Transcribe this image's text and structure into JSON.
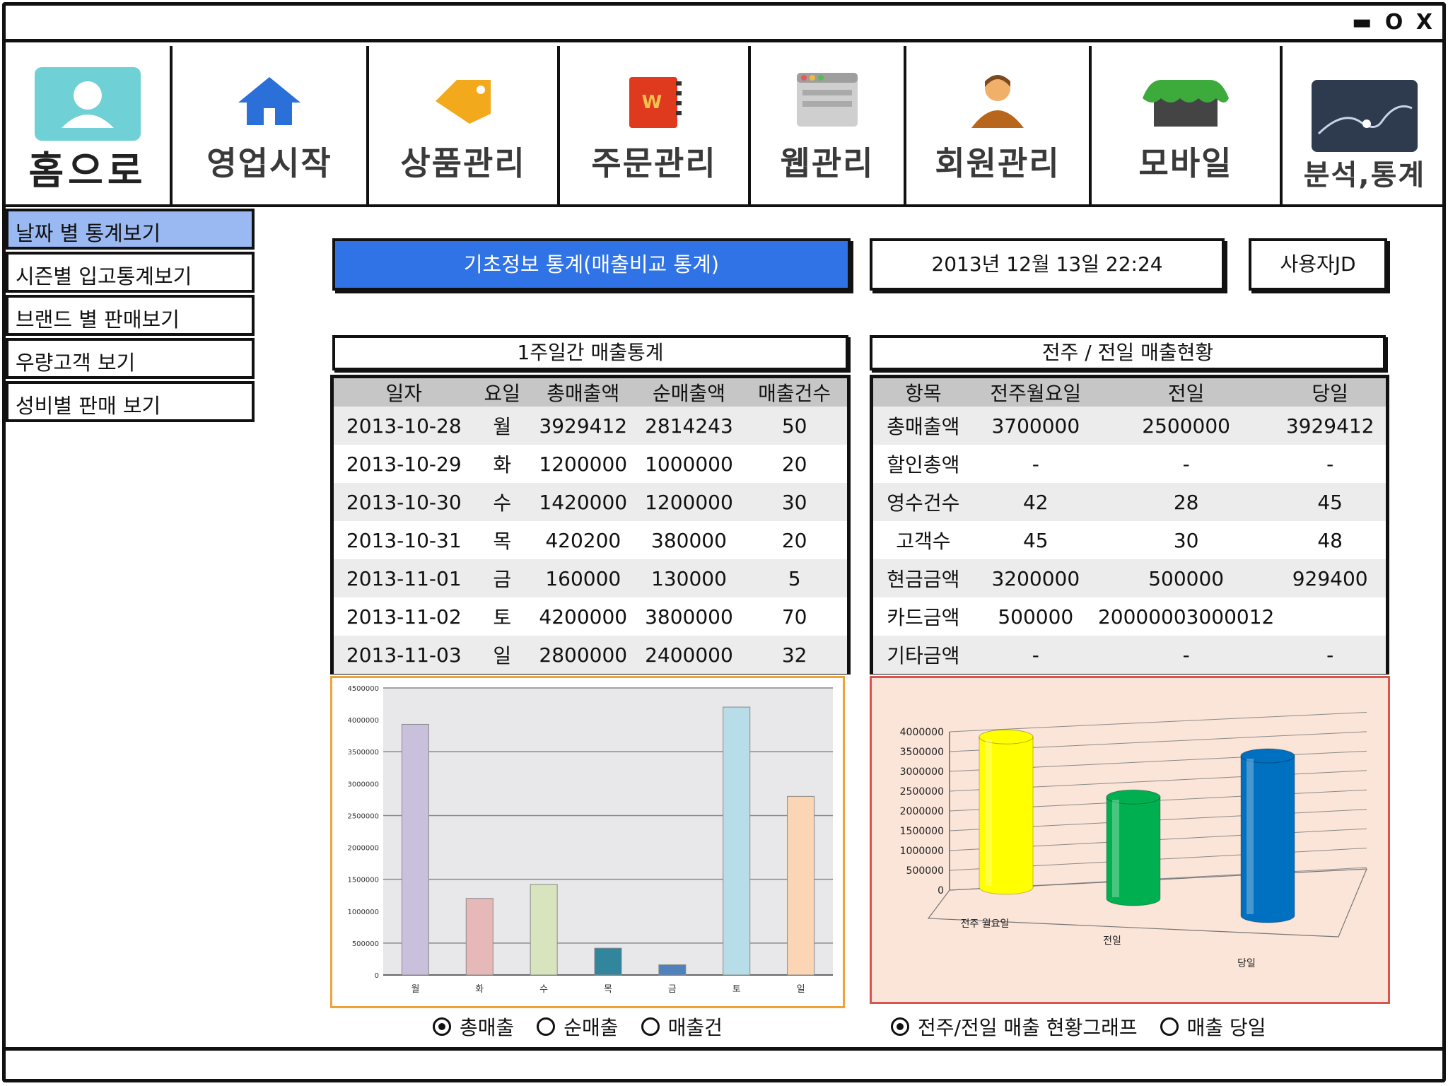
{
  "window": {
    "controls": {
      "minimize": "▬",
      "maximize": "O",
      "close": "X"
    }
  },
  "nav": {
    "home": "홈으로",
    "items": [
      {
        "label": "영업시작",
        "icon": "house-icon"
      },
      {
        "label": "상품관리",
        "icon": "tag-icon"
      },
      {
        "label": "주문관리",
        "icon": "notebook-icon"
      },
      {
        "label": "웹관리",
        "icon": "browser-window-icon"
      },
      {
        "label": "회원관리",
        "icon": "person-icon"
      },
      {
        "label": "모바일",
        "icon": "storefront-icon"
      },
      {
        "label": "분석,통계",
        "icon": "line-chart-icon"
      }
    ]
  },
  "sidebar": {
    "items": [
      {
        "label": "날짜 별 통계보기",
        "active": true
      },
      {
        "label": "시즌별 입고통계보기",
        "active": false
      },
      {
        "label": "브랜드 별 판매보기",
        "active": false
      },
      {
        "label": "우량고객 보기",
        "active": false
      },
      {
        "label": "성비별 판매 보기",
        "active": false
      }
    ]
  },
  "header": {
    "banner": "기초정보 통계(매출비교 통계)",
    "datetime": "2013년 12월 13일 22:24",
    "user": "사용자JD"
  },
  "weekly": {
    "title": "1주일간 매출통계",
    "headers": [
      "일자",
      "요일",
      "총매출액",
      "순매출액",
      "매출건수"
    ],
    "rows": [
      [
        "2013-10-28",
        "월",
        "3929412",
        "2814243",
        "50"
      ],
      [
        "2013-10-29",
        "화",
        "1200000",
        "1000000",
        "20"
      ],
      [
        "2013-10-30",
        "수",
        "1420000",
        "1200000",
        "30"
      ],
      [
        "2013-10-31",
        "목",
        "420200",
        "380000",
        "20"
      ],
      [
        "2013-11-01",
        "금",
        "160000",
        "130000",
        "5"
      ],
      [
        "2013-11-02",
        "토",
        "4200000",
        "3800000",
        "70"
      ],
      [
        "2013-11-03",
        "일",
        "2800000",
        "2400000",
        "32"
      ]
    ]
  },
  "compare": {
    "title": "전주 / 전일 매출현황",
    "headers": [
      "항목",
      "전주월요일",
      "전일",
      "당일"
    ],
    "rows": [
      [
        "총매출액",
        "3700000",
        "2500000",
        "3929412"
      ],
      [
        "할인총액",
        "-",
        "-",
        "-"
      ],
      [
        "영수건수",
        "42",
        "28",
        "45"
      ],
      [
        "고객수",
        "45",
        "30",
        "48"
      ],
      [
        "현금금액",
        "3200000",
        "500000",
        "929400"
      ],
      [
        "카드금액",
        "500000",
        "20000003000012",
        ""
      ],
      [
        "기타금액",
        "-",
        "-",
        "-"
      ]
    ]
  },
  "radios_left": [
    {
      "label": "총매출",
      "checked": true
    },
    {
      "label": "순매출",
      "checked": false
    },
    {
      "label": "매출건",
      "checked": false
    }
  ],
  "radios_right": [
    {
      "label": "전주/전일 매출 현황그래프",
      "checked": true
    },
    {
      "label": "매출 당일",
      "checked": false
    }
  ],
  "chart_data": [
    {
      "type": "bar",
      "categories": [
        "월",
        "화",
        "수",
        "목",
        "금",
        "토",
        "일"
      ],
      "values": [
        3929412,
        1200000,
        1420000,
        420200,
        160000,
        4200000,
        2800000
      ],
      "ylim": [
        0,
        4500000
      ],
      "yticks": [
        "0",
        "500000",
        "1000000",
        "1500000",
        "2000000",
        "2500000",
        "3000000",
        "3500000",
        "4000000",
        "4500000"
      ],
      "colors": [
        "#c9c0dc",
        "#e6b8b7",
        "#d7e4bd",
        "#31859c",
        "#4f81bd",
        "#b7dee8",
        "#fcd5b5"
      ],
      "grid": true
    },
    {
      "type": "bar",
      "style": "3d-cylinder",
      "categories": [
        "전주 월요일",
        "전일",
        "당일"
      ],
      "values": [
        3700000,
        2500000,
        3929412
      ],
      "ylim": [
        0,
        4000000
      ],
      "yticks": [
        "0",
        "500000",
        "1000000",
        "1500000",
        "2000000",
        "2500000",
        "3000000",
        "3500000",
        "4000000"
      ],
      "colors": [
        "#ffff00",
        "#00b050",
        "#0070c0"
      ],
      "grid": true
    }
  ]
}
